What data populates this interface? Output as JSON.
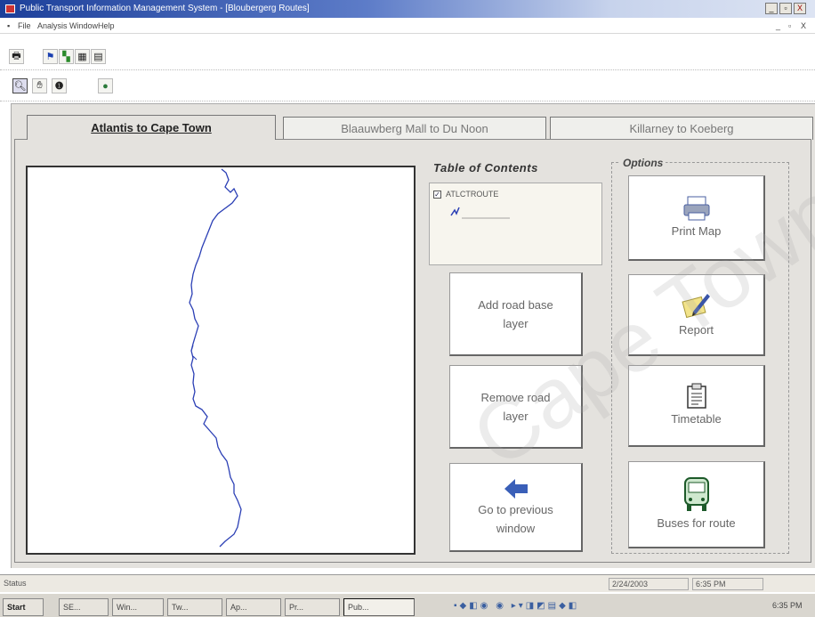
{
  "window": {
    "title": "Public Transport Information Management System - [Bloubergerg Routes]",
    "caption_buttons": [
      "_",
      "▫",
      "X"
    ],
    "inner_buttons": [
      "_",
      "▫",
      "X"
    ]
  },
  "menu": {
    "items": [
      "File",
      "Analysis",
      "Window",
      "Help"
    ]
  },
  "tabs": [
    {
      "label": "Atlantis to Cape Town",
      "active": true
    },
    {
      "label": "Blaauwberg Mall to Du Noon",
      "active": false
    },
    {
      "label": "Killarney to Koeberg",
      "active": false
    }
  ],
  "toc": {
    "title": "Table of Contents",
    "layer_name": "ATLCTROUTE",
    "layer_checked": true
  },
  "actions": {
    "add_road": "Add road base layer",
    "remove_road": "Remove road layer",
    "go_previous": "Go to previous window"
  },
  "options": {
    "label": "Options",
    "print_map": "Print Map",
    "report": "Report",
    "timetable": "Timetable",
    "buses_for_route": "Buses for route"
  },
  "status": {
    "label": "Status",
    "date": "2/24/2003",
    "time": "6:35 PM"
  },
  "taskbar": {
    "start": "Start",
    "tasks": [
      "SE...",
      "Win...",
      "Tw...",
      "Ap...",
      "Pr...",
      "Pub..."
    ],
    "clock": "6:35 PM"
  },
  "watermark": "Cape Town",
  "colors": {
    "route_line": "#2b3fb5",
    "titlebar": "#1c3f9a"
  }
}
